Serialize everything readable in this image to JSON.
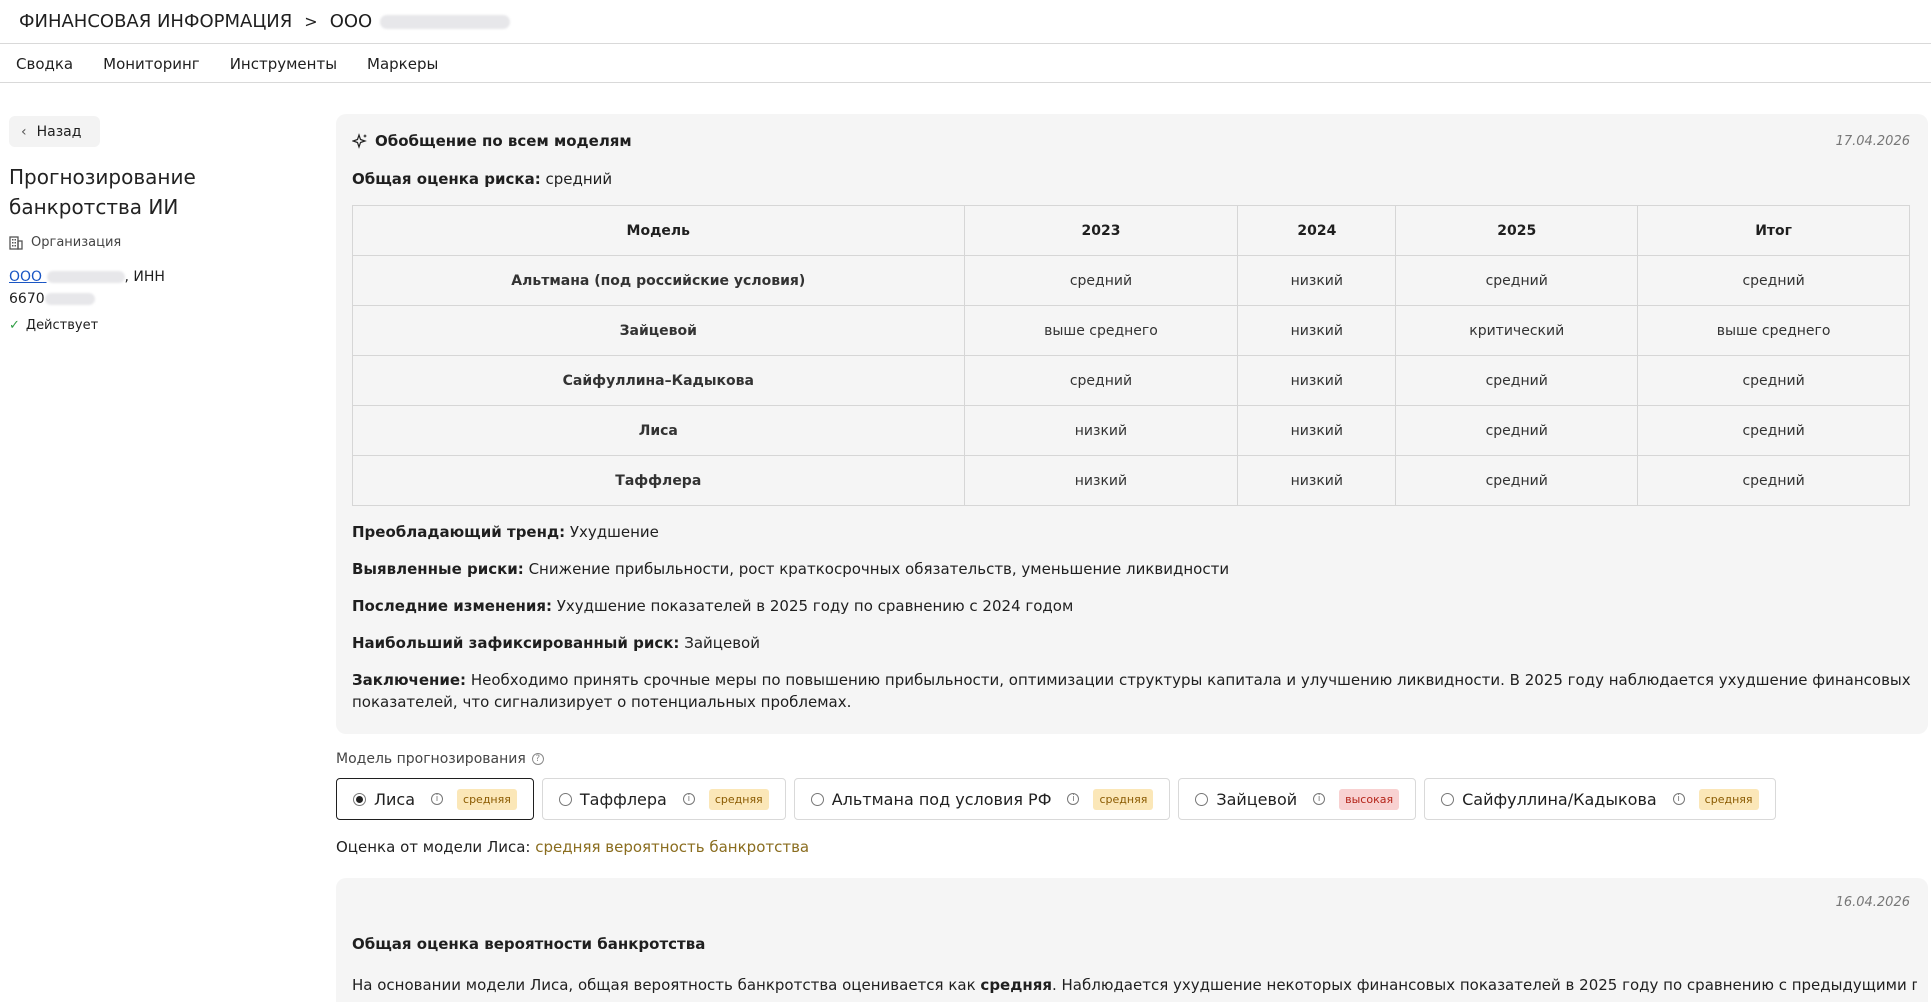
{
  "header": {
    "section_title": "ФИНАНСОВАЯ ИНФОРМАЦИЯ",
    "separator": ">",
    "company_prefix": "ООО"
  },
  "nav": {
    "items": [
      "Сводка",
      "Мониторинг",
      "Инструменты",
      "Маркеры"
    ]
  },
  "sidebar": {
    "back_label": "Назад",
    "title": "Прогнозирование банкротства ИИ",
    "org_label": "Организация",
    "org_prefix": "ООО",
    "inn_label": ", ИНН",
    "inn_prefix": "6670",
    "status": "Действует"
  },
  "summary": {
    "title": "Обобщение по всем моделям",
    "date": "17.04.2026",
    "overall_label": "Общая оценка риска:",
    "overall_value": "средний",
    "table": {
      "headers": [
        "Модель",
        "2023",
        "2024",
        "2025",
        "Итог"
      ],
      "rows": [
        [
          "Альтмана (под российские условия)",
          "средний",
          "низкий",
          "средний",
          "средний"
        ],
        [
          "Зайцевой",
          "выше среднего",
          "низкий",
          "критический",
          "выше среднего"
        ],
        [
          "Сайфуллина–Кадыкова",
          "средний",
          "низкий",
          "средний",
          "средний"
        ],
        [
          "Лиса",
          "низкий",
          "низкий",
          "средний",
          "средний"
        ],
        [
          "Таффлера",
          "низкий",
          "низкий",
          "средний",
          "средний"
        ]
      ]
    },
    "trend_label": "Преобладающий тренд:",
    "trend_value": "Ухудшение",
    "risks_label": "Выявленные риски:",
    "risks_value": "Снижение прибыльности, рост краткосрочных обязательств, уменьшение ликвидности",
    "changes_label": "Последние изменения:",
    "changes_value": "Ухудшение показателей в 2025 году по сравнению с 2024 годом",
    "max_risk_label": "Наибольший зафиксированный риск:",
    "max_risk_value": "Зайцевой",
    "conclusion_label": "Заключение:",
    "conclusion_value": "Необходимо принять срочные меры по повышению прибыльности, оптимизации структуры капитала и улучшению ликвидности. В 2025 году наблюдается ухудшение финансовых показателей, что сигнализирует о потенциальных проблемах."
  },
  "model_select": {
    "caption": "Модель прогнозирования",
    "options": [
      {
        "label": "Лиса",
        "badge": "средняя",
        "level": "mid",
        "selected": true
      },
      {
        "label": "Таффлера",
        "badge": "средняя",
        "level": "mid",
        "selected": false
      },
      {
        "label": "Альтмана под условия РФ",
        "badge": "средняя",
        "level": "mid",
        "selected": false
      },
      {
        "label": "Зайцевой",
        "badge": "высокая",
        "level": "high",
        "selected": false
      },
      {
        "label": "Сайфуллина/Кадыкова",
        "badge": "средняя",
        "level": "mid",
        "selected": false
      }
    ],
    "result_label": "Оценка от модели Лиса:",
    "result_value": "средняя вероятность банкротства"
  },
  "detail": {
    "date": "16.04.2026",
    "title": "Общая оценка вероятности банкротства",
    "text_before": "На основании модели Лиса, общая вероятность банкротства оценивается как ",
    "text_bold": "средняя",
    "text_after": ". Наблюдается ухудшение некоторых финансовых показателей в 2025 году по сравнению с предыдущими годами, что требует"
  },
  "colors": {
    "card_bg": "#f5f5f5",
    "link": "#1a56c4",
    "status_green": "#2f9e44",
    "badge_mid_bg": "#fbe7b8",
    "badge_high_bg": "#f8d1d1",
    "result_accent": "#8a6d1f"
  }
}
